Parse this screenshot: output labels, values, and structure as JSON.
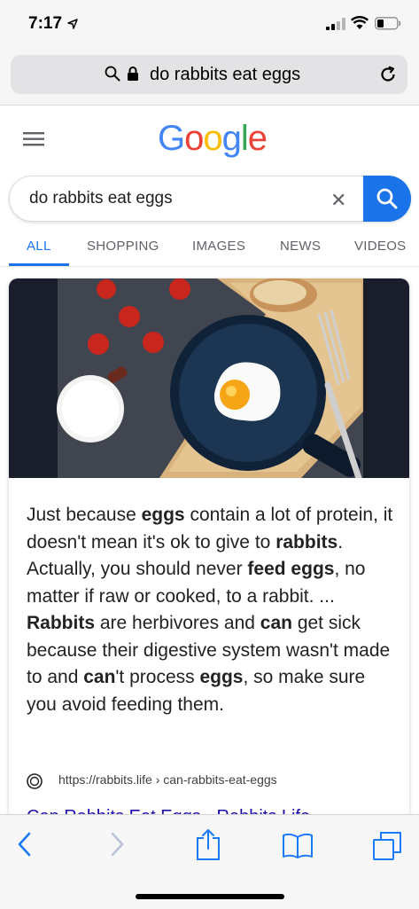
{
  "status_bar": {
    "time": "7:17"
  },
  "safari": {
    "url_display": "do rabbits eat eggs"
  },
  "google": {
    "logo_letters": [
      "G",
      "o",
      "o",
      "g",
      "l",
      "e"
    ],
    "query": "do rabbits eat eggs",
    "clear_symbol": "✕",
    "tabs": [
      "ALL",
      "SHOPPING",
      "IMAGES",
      "NEWS",
      "VIDEOS"
    ]
  },
  "featured_snippet": {
    "text_parts": [
      {
        "t": "Just because ",
        "b": false
      },
      {
        "t": "eggs",
        "b": true
      },
      {
        "t": " contain a lot of protein, it doesn't mean it's ok to give to ",
        "b": false
      },
      {
        "t": "rabbits",
        "b": true
      },
      {
        "t": ". Actually, you should never ",
        "b": false
      },
      {
        "t": "feed eggs",
        "b": true
      },
      {
        "t": ", no matter if raw or cooked, to a rabbit. ... ",
        "b": false
      },
      {
        "t": "Rabbits",
        "b": true
      },
      {
        "t": " are herbivores and ",
        "b": false
      },
      {
        "t": "can",
        "b": true
      },
      {
        "t": " get sick because their digestive system wasn't made to and ",
        "b": false
      },
      {
        "t": "can",
        "b": true
      },
      {
        "t": "'t process ",
        "b": false
      },
      {
        "t": "eggs",
        "b": true
      },
      {
        "t": ", so make sure you avoid feeding them.",
        "b": false
      }
    ],
    "source_url": "https://rabbits.life › can-rabbits-eat-eggs",
    "result_title": "Can Rabbits Eat Eggs - Rabbits Life"
  },
  "colors": {
    "accent": "#1a73e8",
    "link": "#1a0dab",
    "ios_blue": "#1a7af7"
  }
}
